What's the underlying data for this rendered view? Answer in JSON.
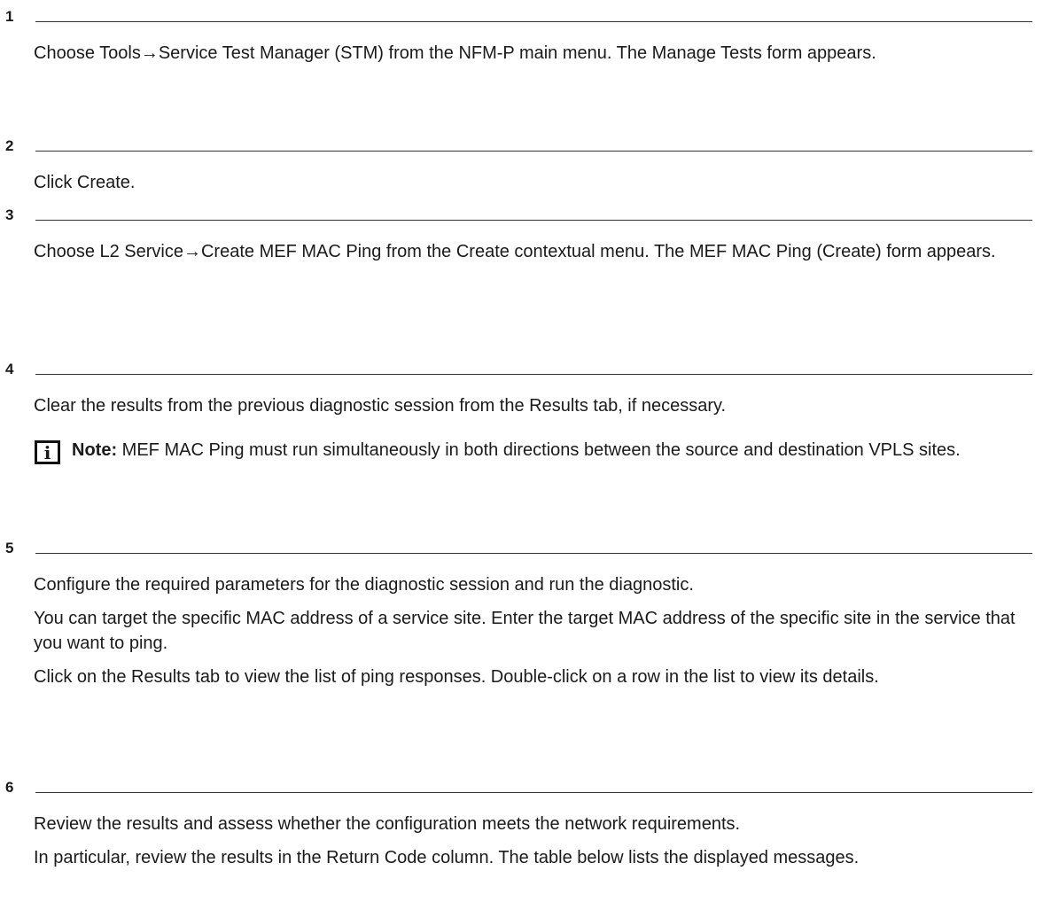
{
  "steps": [
    {
      "number": "1",
      "paragraphs": [
        "Choose Tools→Service Test Manager (STM) from the NFM-P main menu. The Manage Tests form appears."
      ]
    },
    {
      "number": "2",
      "paragraphs": [
        "Click Create."
      ]
    },
    {
      "number": "3",
      "paragraphs": [
        "Choose L2 Service→Create MEF MAC Ping from the Create contextual menu. The MEF MAC Ping (Create) form appears."
      ]
    },
    {
      "number": "4",
      "paragraphs": [
        "Clear the results from the previous diagnostic session from the Results tab, if necessary."
      ],
      "note": {
        "icon": "info-icon",
        "icon_glyph": "i",
        "label": "Note:",
        "text": " MEF MAC Ping must run simultaneously in both directions between the source and destination VPLS sites."
      }
    },
    {
      "number": "5",
      "paragraphs": [
        "Configure the required parameters for the diagnostic session and run the diagnostic.",
        "You can target the specific MAC address of a service site. Enter the target MAC address of the specific site in the service that you want to ping.",
        "Click on the Results tab to view the list of ping responses. Double-click on a row in the list to view its details."
      ]
    },
    {
      "number": "6",
      "paragraphs": [
        "Review the results and assess whether the configuration meets the network requirements.",
        "In particular, review the results in the Return Code column. The table below lists the displayed messages."
      ]
    }
  ]
}
